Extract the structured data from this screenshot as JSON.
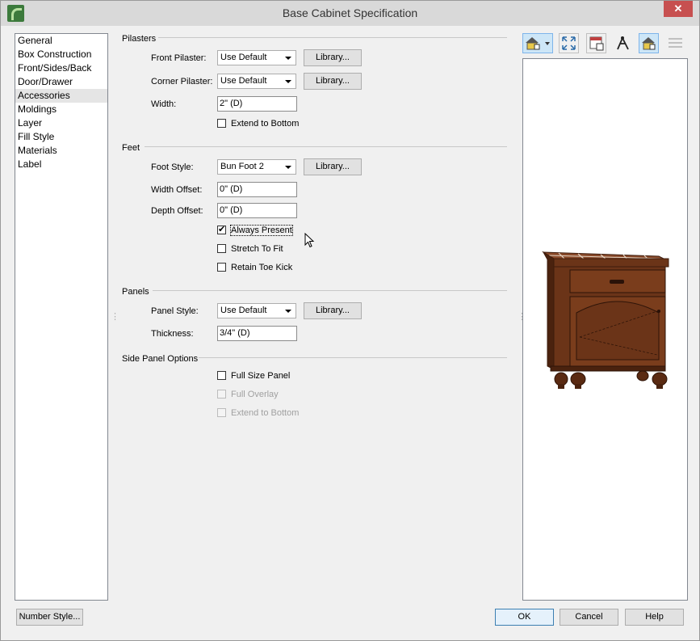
{
  "window": {
    "title": "Base Cabinet Specification",
    "close_glyph": "✕"
  },
  "nav": {
    "items": [
      {
        "label": "General"
      },
      {
        "label": "Box Construction"
      },
      {
        "label": "Front/Sides/Back"
      },
      {
        "label": "Door/Drawer"
      },
      {
        "label": "Accessories",
        "selected": true
      },
      {
        "label": "Moldings"
      },
      {
        "label": "Layer"
      },
      {
        "label": "Fill Style"
      },
      {
        "label": "Materials"
      },
      {
        "label": "Label"
      }
    ]
  },
  "pilasters": {
    "heading": "Pilasters",
    "front_label": "Front Pilaster:",
    "front_value": "Use Default",
    "corner_label": "Corner Pilaster:",
    "corner_value": "Use Default",
    "width_label": "Width:",
    "width_value": "2\" (D)",
    "extend_label": "Extend to Bottom",
    "library_label": "Library..."
  },
  "feet": {
    "heading": "Feet",
    "style_label": "Foot Style:",
    "style_value": "Bun Foot 2",
    "width_offset_label": "Width Offset:",
    "width_offset_value": "0\" (D)",
    "depth_offset_label": "Depth Offset:",
    "depth_offset_value": "0\" (D)",
    "always_present_label": "Always Present",
    "stretch_label": "Stretch To Fit",
    "toe_kick_label": "Retain Toe Kick",
    "library_label": "Library..."
  },
  "panels": {
    "heading": "Panels",
    "style_label": "Panel Style:",
    "style_value": "Use Default",
    "thickness_label": "Thickness:",
    "thickness_value": "3/4\" (D)",
    "library_label": "Library..."
  },
  "side_panel": {
    "heading": "Side Panel Options",
    "full_size_label": "Full Size Panel",
    "full_overlay_label": "Full Overlay",
    "extend_label": "Extend to Bottom"
  },
  "footer": {
    "number_style": "Number Style...",
    "ok": "OK",
    "cancel": "Cancel",
    "help": "Help"
  },
  "colors": {
    "wood": "#6b3418",
    "wood_dark": "#3e1c0c",
    "tile": "#b9674d",
    "accent": "#3c7fb1"
  }
}
